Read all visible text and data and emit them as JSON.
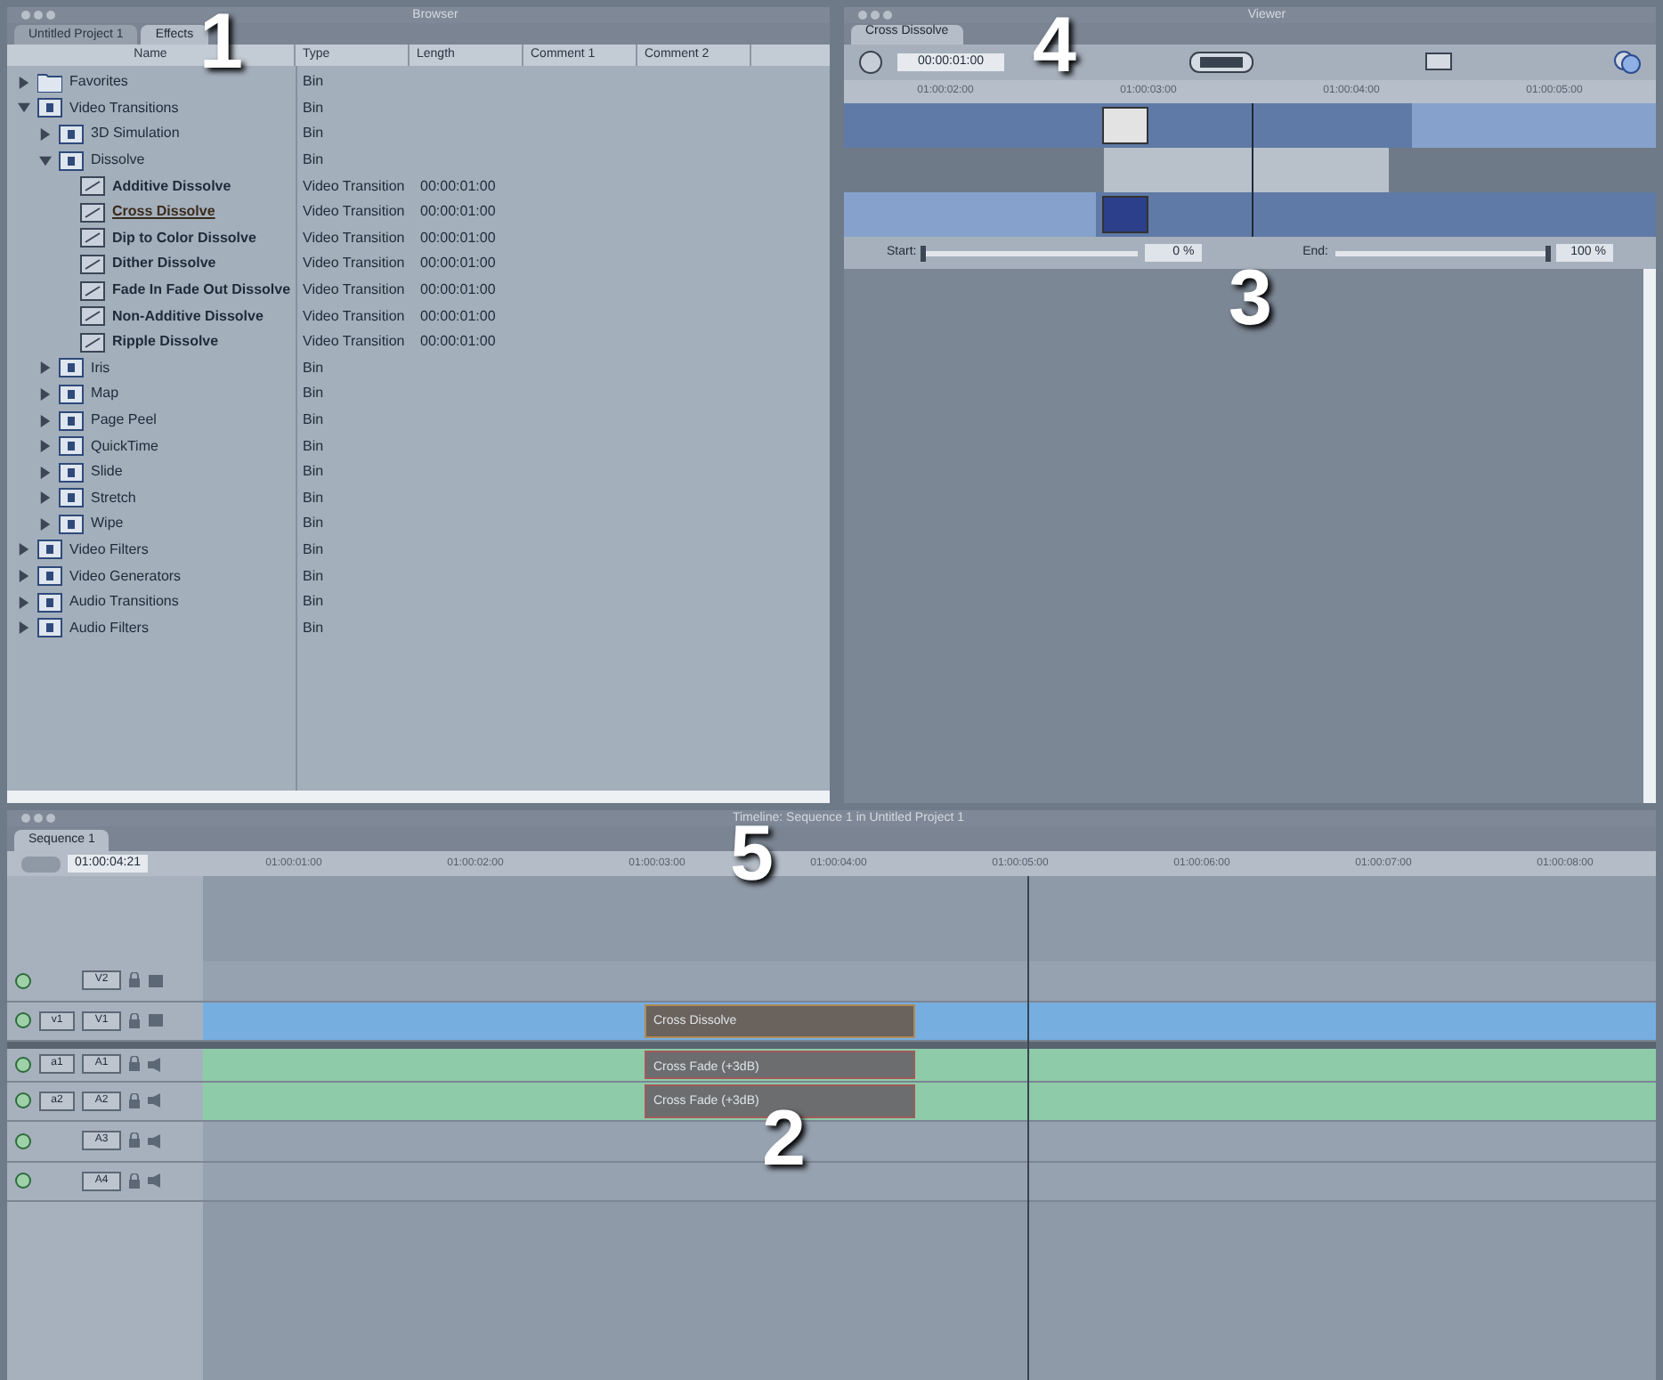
{
  "browser": {
    "title": "Browser",
    "tabs": [
      {
        "label": "Untitled Project 1",
        "selected": false
      },
      {
        "label": "Effects",
        "selected": true
      }
    ],
    "columns": [
      "Name",
      "Type",
      "Length",
      "Comment 1",
      "Comment 2"
    ],
    "tree": [
      {
        "name": "Favorites",
        "type": "Bin",
        "kind": "folder",
        "expanded": false
      },
      {
        "name": "Video Transitions",
        "type": "Bin",
        "kind": "bin",
        "expanded": true,
        "children": [
          {
            "name": "3D Simulation",
            "type": "Bin",
            "kind": "bin",
            "expanded": false
          },
          {
            "name": "Dissolve",
            "type": "Bin",
            "kind": "bin",
            "expanded": true,
            "children": [
              {
                "name": "Additive Dissolve",
                "type": "Video Transition",
                "length": "00:00:01:00",
                "kind": "transition",
                "selected": false
              },
              {
                "name": "Cross Dissolve",
                "type": "Video Transition",
                "length": "00:00:01:00",
                "kind": "transition",
                "selected": true
              },
              {
                "name": "Dip to Color Dissolve",
                "type": "Video Transition",
                "length": "00:00:01:00",
                "kind": "transition",
                "selected": false
              },
              {
                "name": "Dither Dissolve",
                "type": "Video Transition",
                "length": "00:00:01:00",
                "kind": "transition",
                "selected": false
              },
              {
                "name": "Fade In Fade Out Dissolve",
                "type": "Video Transition",
                "length": "00:00:01:00",
                "kind": "transition",
                "selected": false
              },
              {
                "name": "Non-Additive Dissolve",
                "type": "Video Transition",
                "length": "00:00:01:00",
                "kind": "transition",
                "selected": false
              },
              {
                "name": "Ripple Dissolve",
                "type": "Video Transition",
                "length": "00:00:01:00",
                "kind": "transition",
                "selected": false
              }
            ]
          },
          {
            "name": "Iris",
            "type": "Bin",
            "kind": "bin",
            "expanded": false
          },
          {
            "name": "Map",
            "type": "Bin",
            "kind": "bin",
            "expanded": false
          },
          {
            "name": "Page Peel",
            "type": "Bin",
            "kind": "bin",
            "expanded": false
          },
          {
            "name": "QuickTime",
            "type": "Bin",
            "kind": "bin",
            "expanded": false
          },
          {
            "name": "Slide",
            "type": "Bin",
            "kind": "bin",
            "expanded": false
          },
          {
            "name": "Stretch",
            "type": "Bin",
            "kind": "bin",
            "expanded": false
          },
          {
            "name": "Wipe",
            "type": "Bin",
            "kind": "bin",
            "expanded": false
          }
        ]
      },
      {
        "name": "Video Filters",
        "type": "Bin",
        "kind": "bin",
        "expanded": false
      },
      {
        "name": "Video Generators",
        "type": "Bin",
        "kind": "bin",
        "expanded": false
      },
      {
        "name": "Audio Transitions",
        "type": "Bin",
        "kind": "bin",
        "expanded": false
      },
      {
        "name": "Audio Filters",
        "type": "Bin",
        "kind": "bin",
        "expanded": false
      }
    ]
  },
  "viewer": {
    "title": "Viewer",
    "tab": "Cross Dissolve",
    "duration": "00:00:01:00",
    "ruler": [
      "01:00:02:00",
      "01:00:03:00",
      "01:00:04:00",
      "01:00:05:00"
    ],
    "start": {
      "label": "Start:",
      "level": 0,
      "value": "0 %"
    },
    "end": {
      "label": "End:",
      "level": 1,
      "value": "100 %"
    }
  },
  "timeline": {
    "title": "Timeline: Sequence 1 in Untitled Project 1",
    "tab": "Sequence 1",
    "timecode": "01:00:04:21",
    "ruler": [
      "01:00:01:00",
      "01:00:02:00",
      "01:00:03:00",
      "01:00:04:00",
      "01:00:05:00",
      "01:00:06:00",
      "01:00:07:00",
      "01:00:08:00"
    ],
    "tracks": [
      {
        "name": "V2",
        "kind": "video"
      },
      {
        "name": "V1",
        "source": "v1",
        "kind": "video",
        "clip": "Cross Dissolve"
      },
      {
        "name": "A1",
        "source": "a1",
        "kind": "audio",
        "clip": "Cross Fade (+3dB)"
      },
      {
        "name": "A2",
        "source": "a2",
        "kind": "audio",
        "clip": "Cross Fade (+3dB)"
      },
      {
        "name": "A3",
        "kind": "audio"
      },
      {
        "name": "A4",
        "kind": "audio"
      }
    ]
  },
  "callouts": [
    "1",
    "4",
    "3",
    "5",
    "2"
  ]
}
